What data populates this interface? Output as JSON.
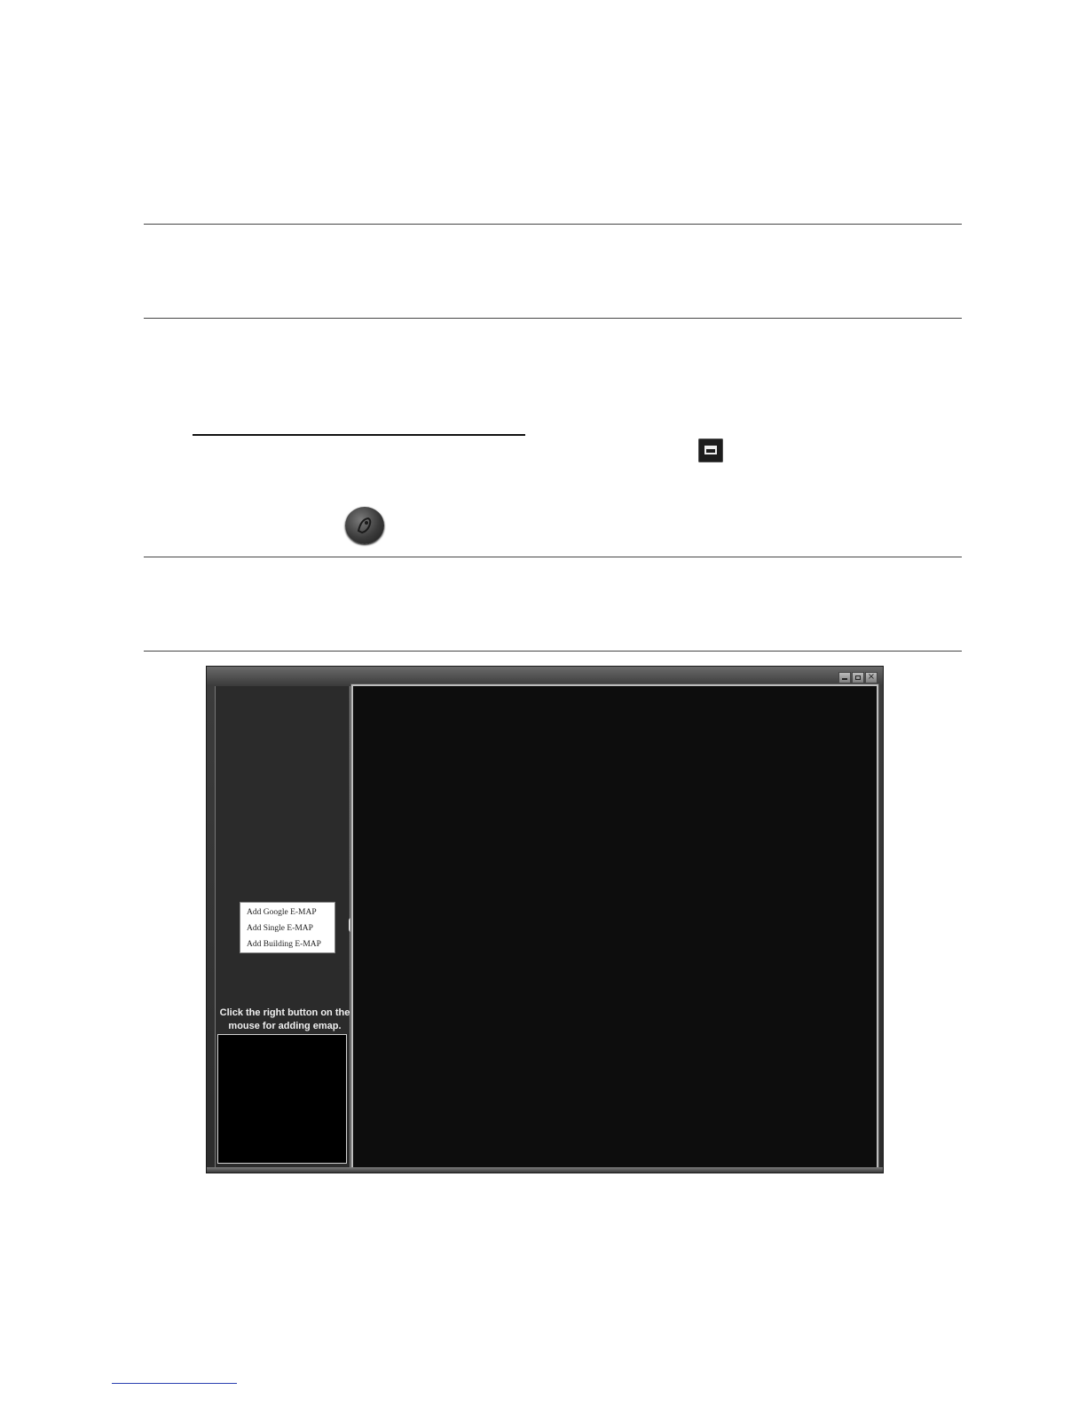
{
  "app_window": {
    "title": "",
    "context_menu": {
      "items": [
        {
          "label": "Add Google E-MAP"
        },
        {
          "label": "Add Single E-MAP"
        },
        {
          "label": "Add Building E-MAP"
        }
      ]
    },
    "hint": {
      "line1": "Click the right button on the",
      "line2": "mouse for adding emap."
    },
    "icons": {
      "minimize": "minimize-icon",
      "restore": "restore-icon",
      "close": "close-icon",
      "close_glyph": "×",
      "collapse_glyph": "‹"
    }
  },
  "page_icons": {
    "window": "window-icon",
    "emap": "emap-knob-icon"
  }
}
